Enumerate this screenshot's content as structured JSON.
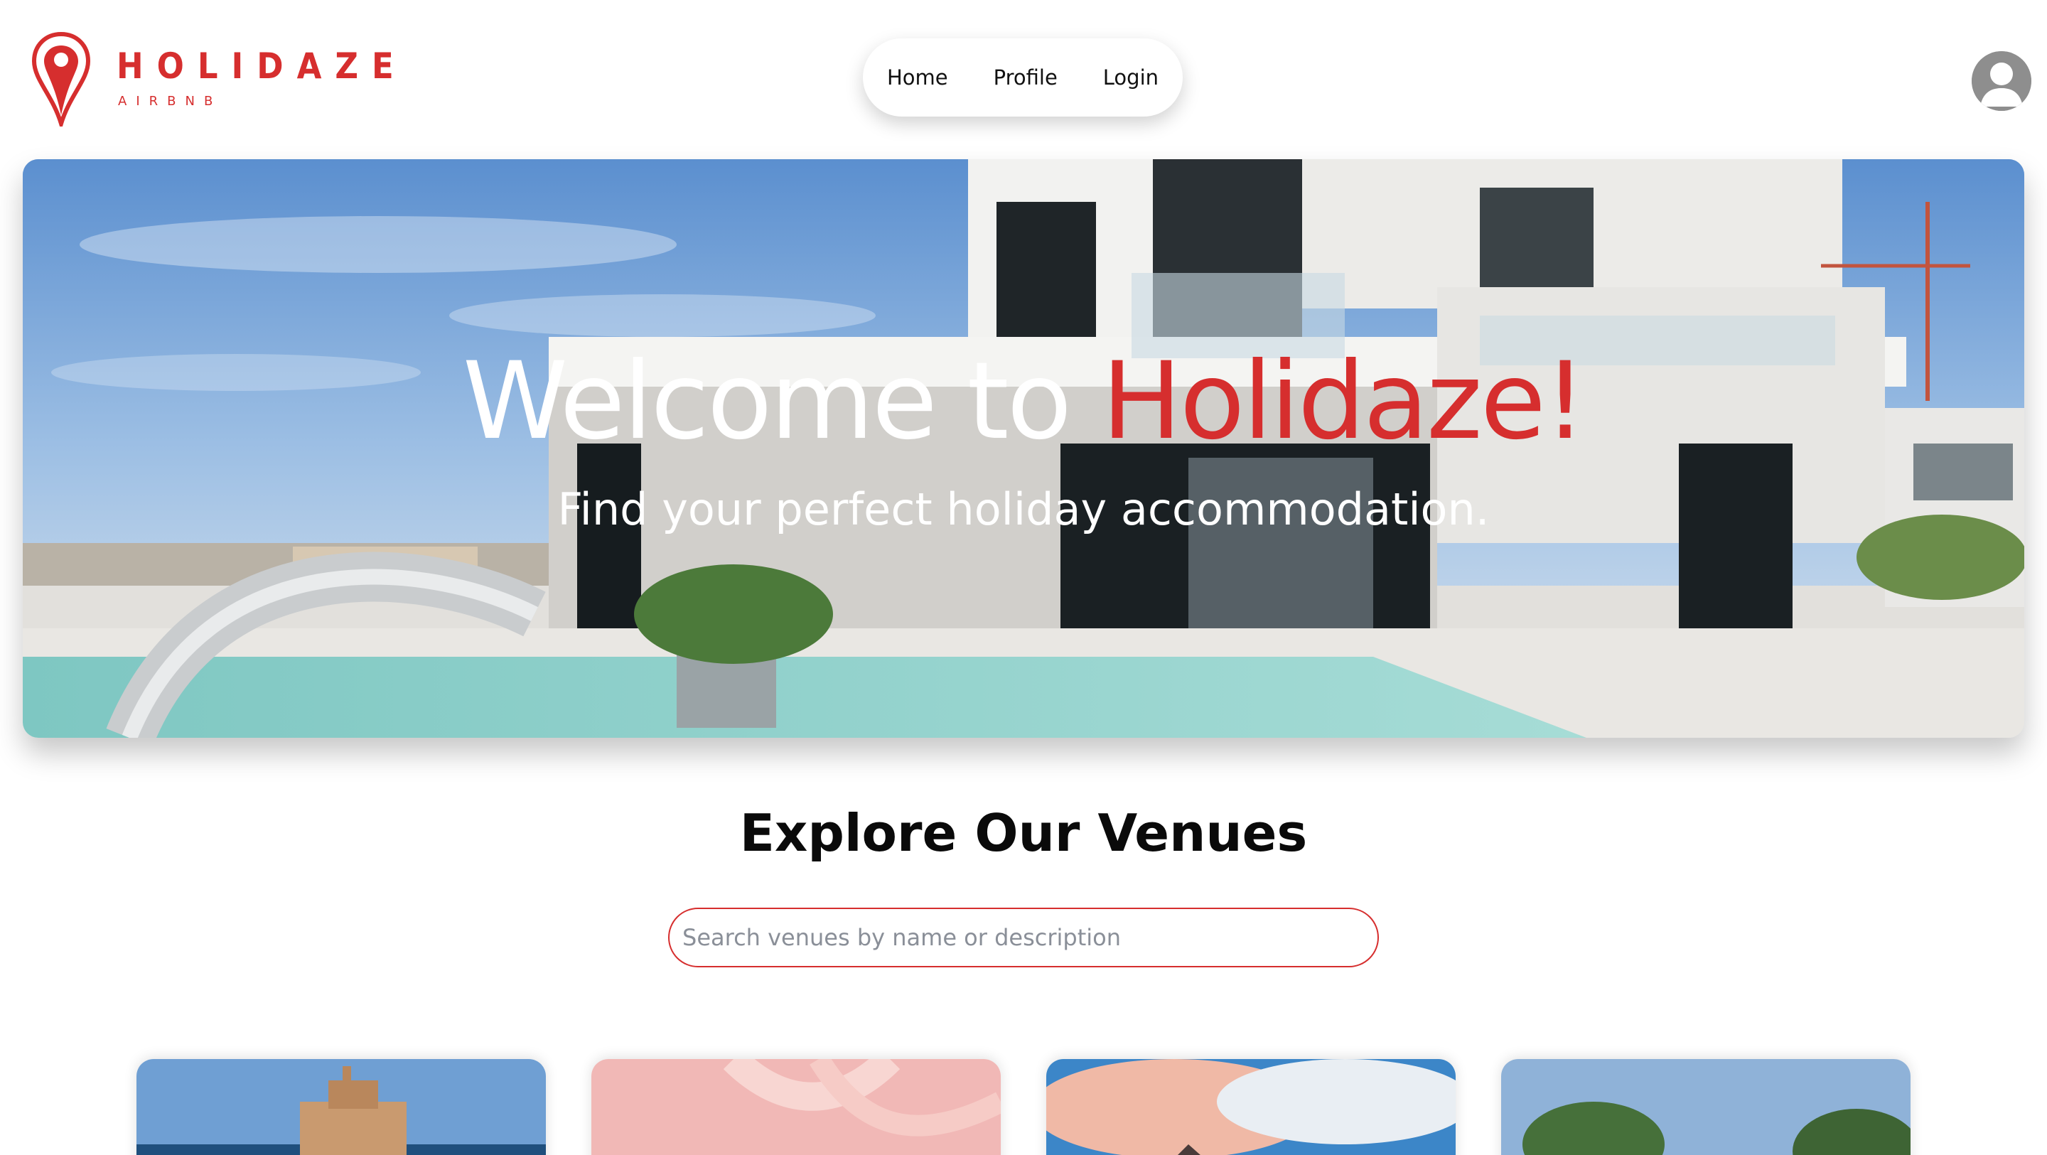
{
  "brand": {
    "name": "HOLIDAZE",
    "tagline": "AIRBNB",
    "color": "#d62e2e"
  },
  "nav": {
    "items": [
      {
        "label": "Home"
      },
      {
        "label": "Profile"
      },
      {
        "label": "Login"
      }
    ]
  },
  "user": {
    "avatar_icon": "user-avatar-icon"
  },
  "hero": {
    "title_prefix": "Welcome to ",
    "title_accent": "Holidaze!",
    "subtitle": "Find your perfect holiday accommodation."
  },
  "explore": {
    "heading": "Explore Our Venues",
    "search_placeholder": "Search venues by name or description"
  },
  "venues": [
    {},
    {},
    {},
    {}
  ]
}
